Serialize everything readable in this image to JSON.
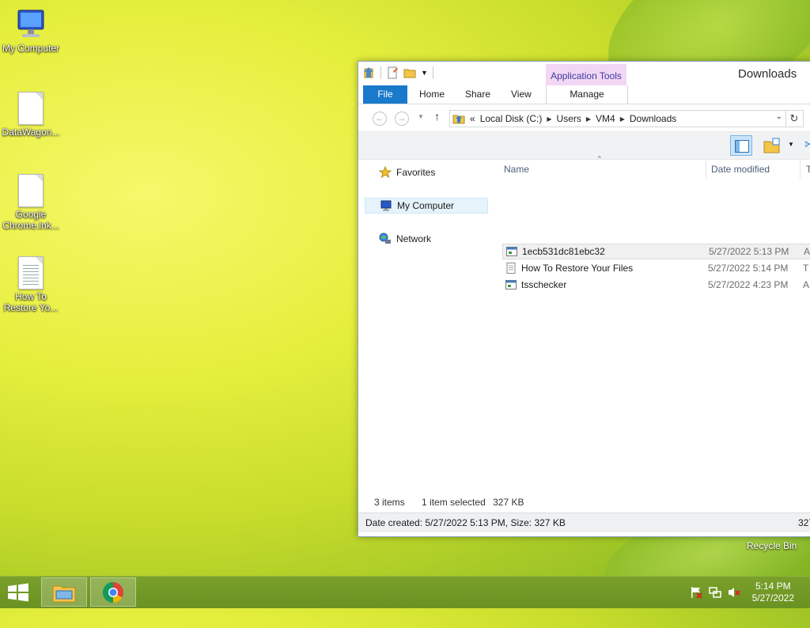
{
  "desktop": {
    "icons": [
      {
        "label": "My Computer",
        "icon": "monitor-icon"
      },
      {
        "label": "DataWagon...",
        "icon": "document-icon"
      },
      {
        "label": "Google Chrome.lnk...",
        "icon": "document-icon"
      },
      {
        "label": "How To Restore Yo...",
        "icon": "text-document-icon"
      }
    ],
    "recycle_bin": "Recycle Bin"
  },
  "window": {
    "title": "Downloads",
    "contextual_tab": "Application Tools",
    "ribbon_tabs": {
      "file": "File",
      "home": "Home",
      "share": "Share",
      "view": "View",
      "manage": "Manage"
    },
    "address": {
      "overflow": "«",
      "crumbs": [
        "Local Disk (C:)",
        "Users",
        "VM4",
        "Downloads"
      ]
    },
    "nav_pane": {
      "favorites": "Favorites",
      "my_computer": "My Computer",
      "network": "Network"
    },
    "columns": {
      "name": "Name",
      "date_modified": "Date modified",
      "type": "T"
    },
    "files": [
      {
        "name": "1ecb531dc81ebc32",
        "date": "5/27/2022 5:13 PM",
        "type": "A",
        "icon": "application-icon",
        "selected": true
      },
      {
        "name": "How To Restore Your Files",
        "date": "5/27/2022 5:14 PM",
        "type": "T",
        "icon": "text-file-icon",
        "selected": false
      },
      {
        "name": "tsschecker",
        "date": "5/27/2022 4:23 PM",
        "type": "A",
        "icon": "application-icon",
        "selected": false
      }
    ],
    "status": {
      "items": "3 items",
      "selected": "1 item selected",
      "size": "327 KB"
    },
    "details": {
      "text": "Date created: 5/27/2022 5:13 PM, Size: 327 KB",
      "right": "327"
    }
  },
  "taskbar": {
    "time": "5:14 PM",
    "date": "5/27/2022"
  }
}
